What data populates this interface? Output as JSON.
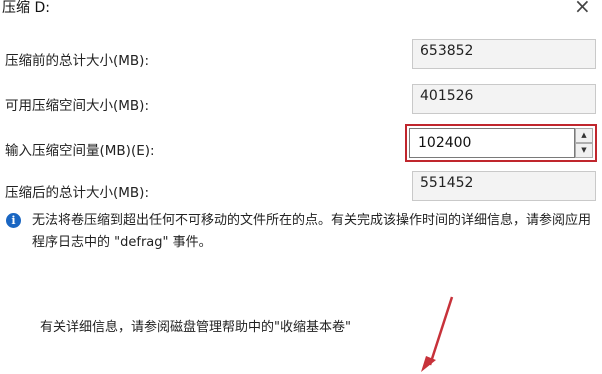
{
  "window": {
    "title": "压缩 D:",
    "close_glyph": "×"
  },
  "fields": [
    {
      "label": "压缩前的总计大小(MB):",
      "value": "653852"
    },
    {
      "label": "可用压缩空间大小(MB):",
      "value": "401526"
    },
    {
      "label": "输入压缩空间量(MB)(E):",
      "value": "102400"
    },
    {
      "label": "压缩后的总计大小(MB):",
      "value": "551452"
    }
  ],
  "spinner": {
    "up_glyph": "▲",
    "down_glyph": "▼"
  },
  "info": {
    "icon": "info-icon",
    "icon_glyph": "i",
    "text": "无法将卷压缩到超出任何不可移动的文件所在的点。有关完成该操作时间的详细信息，请参阅应用程序日志中的 \"defrag\" 事件。"
  },
  "help": {
    "text": "有关详细信息，请参阅磁盘管理帮助中的\"收缩基本卷\""
  },
  "colors": {
    "highlight": "#c0262d",
    "info_icon": "#1a66c2"
  }
}
